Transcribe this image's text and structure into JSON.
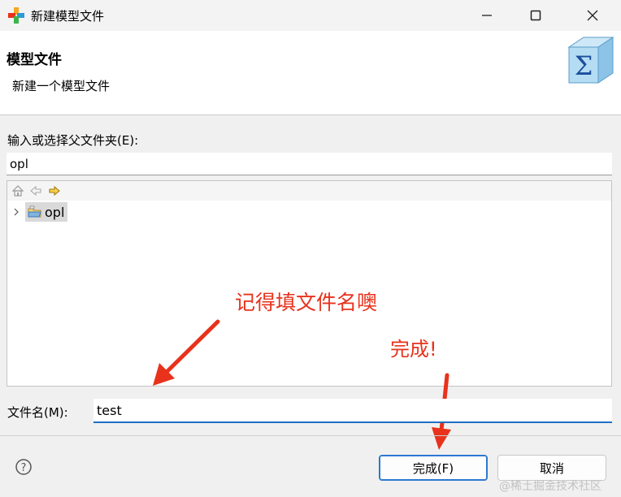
{
  "window": {
    "title": "新建模型文件",
    "icons": {
      "app": "plus-cross-app-icon",
      "minimize": "minimize-icon",
      "maximize": "maximize-icon",
      "close": "close-icon"
    }
  },
  "banner": {
    "title": "模型文件",
    "description": "新建一个模型文件",
    "image": "sigma-cube-icon"
  },
  "parent_folder": {
    "label": "输入或选择父文件夹(E):",
    "value": "opl"
  },
  "tree": {
    "toolbar_icons": [
      "home-icon",
      "back-arrow-icon",
      "forward-arrow-icon"
    ],
    "items": [
      {
        "label": "opl",
        "icon": "project-folder-icon",
        "expander": "chevron-right-icon"
      }
    ]
  },
  "annotations": {
    "note_filename": "记得填文件名噢",
    "note_finish": "完成!",
    "color": "#e8321c"
  },
  "file_name": {
    "label": "文件名(M):",
    "value": "test"
  },
  "footer": {
    "help_icon": "help-icon",
    "finish_label": "完成(F)",
    "cancel_label": "取消"
  },
  "watermark": "@稀土掘金技术社区",
  "colors": {
    "accent": "#1f6fc5",
    "annotation": "#e8321c"
  }
}
